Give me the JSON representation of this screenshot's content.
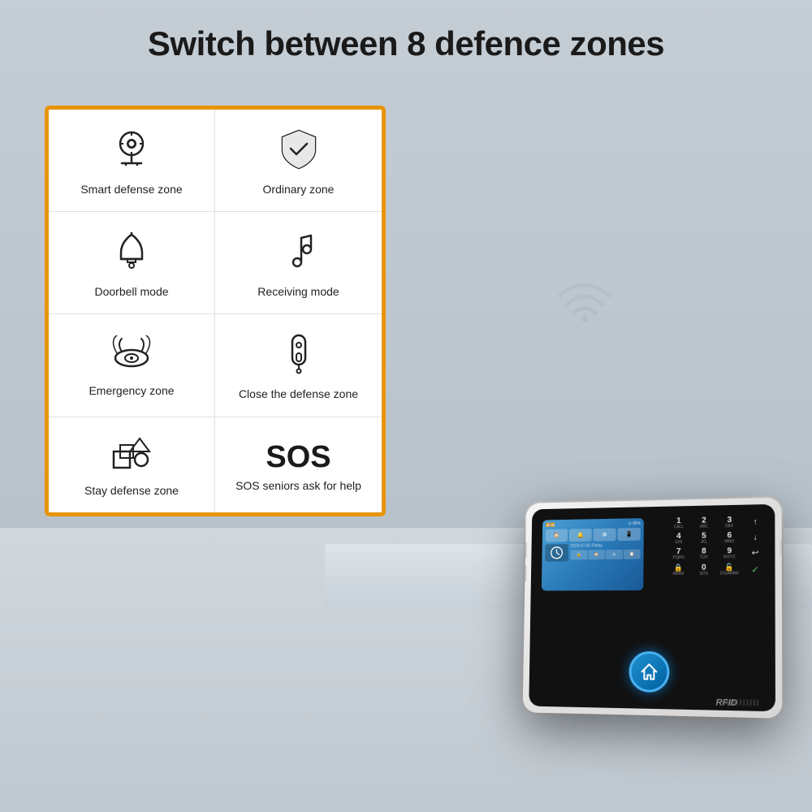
{
  "page": {
    "title": "Switch between 8 defence zones",
    "background_color": "#b0b8c0"
  },
  "info_card": {
    "border_color": "#e8940a",
    "zones": [
      {
        "id": "smart-defense",
        "icon": "brain-gear",
        "label": "Smart defense zone",
        "icon_char": "🧠",
        "icon_svg": "brain"
      },
      {
        "id": "ordinary",
        "icon": "shield",
        "label": "Ordinary zone",
        "icon_char": "🛡"
      },
      {
        "id": "doorbell",
        "icon": "bell",
        "label": "Doorbell mode",
        "icon_char": "🔔"
      },
      {
        "id": "receiving",
        "icon": "music-note",
        "label": "Receiving mode",
        "icon_char": "♪"
      },
      {
        "id": "emergency",
        "icon": "smoke-detector",
        "label": "Emergency zone",
        "icon_char": "🚨"
      },
      {
        "id": "close-defense",
        "icon": "key-fob",
        "label": "Close the defense zone",
        "icon_char": "🔑"
      },
      {
        "id": "stay-defense",
        "icon": "shapes",
        "label": "Stay defense zone",
        "icon_char": "◻"
      },
      {
        "id": "sos",
        "icon": "sos",
        "label": "SOS seniors ask for help",
        "icon_char": "SOS",
        "is_sos": true
      }
    ]
  },
  "device": {
    "brand": "RFID",
    "keypad": [
      {
        "num": "1",
        "letters": "CALL",
        "row": 0,
        "col": 0
      },
      {
        "num": "2",
        "letters": "ABC",
        "row": 0,
        "col": 1
      },
      {
        "num": "3",
        "letters": "DEF",
        "row": 0,
        "col": 2
      },
      {
        "num": "↑",
        "letters": "",
        "row": 0,
        "col": 3
      },
      {
        "num": "4",
        "letters": "GHI",
        "row": 1,
        "col": 0
      },
      {
        "num": "5",
        "letters": "JKL",
        "row": 1,
        "col": 1
      },
      {
        "num": "6",
        "letters": "MNO",
        "row": 1,
        "col": 2
      },
      {
        "num": "↓",
        "letters": "",
        "row": 1,
        "col": 3
      },
      {
        "num": "7",
        "letters": "PQRS",
        "row": 2,
        "col": 0
      },
      {
        "num": "8",
        "letters": "TUV",
        "row": 2,
        "col": 1
      },
      {
        "num": "9",
        "letters": "WXYZ",
        "row": 2,
        "col": 2
      },
      {
        "num": "↩",
        "letters": "",
        "row": 2,
        "col": 3
      },
      {
        "num": "🔒",
        "letters": "ARM#",
        "row": 3,
        "col": 0
      },
      {
        "num": "0",
        "letters": "SOS",
        "row": 3,
        "col": 1
      },
      {
        "num": "🔓",
        "letters": "DISARM#",
        "row": 3,
        "col": 2
      },
      {
        "num": "✓",
        "letters": "",
        "row": 3,
        "col": 3
      }
    ]
  }
}
